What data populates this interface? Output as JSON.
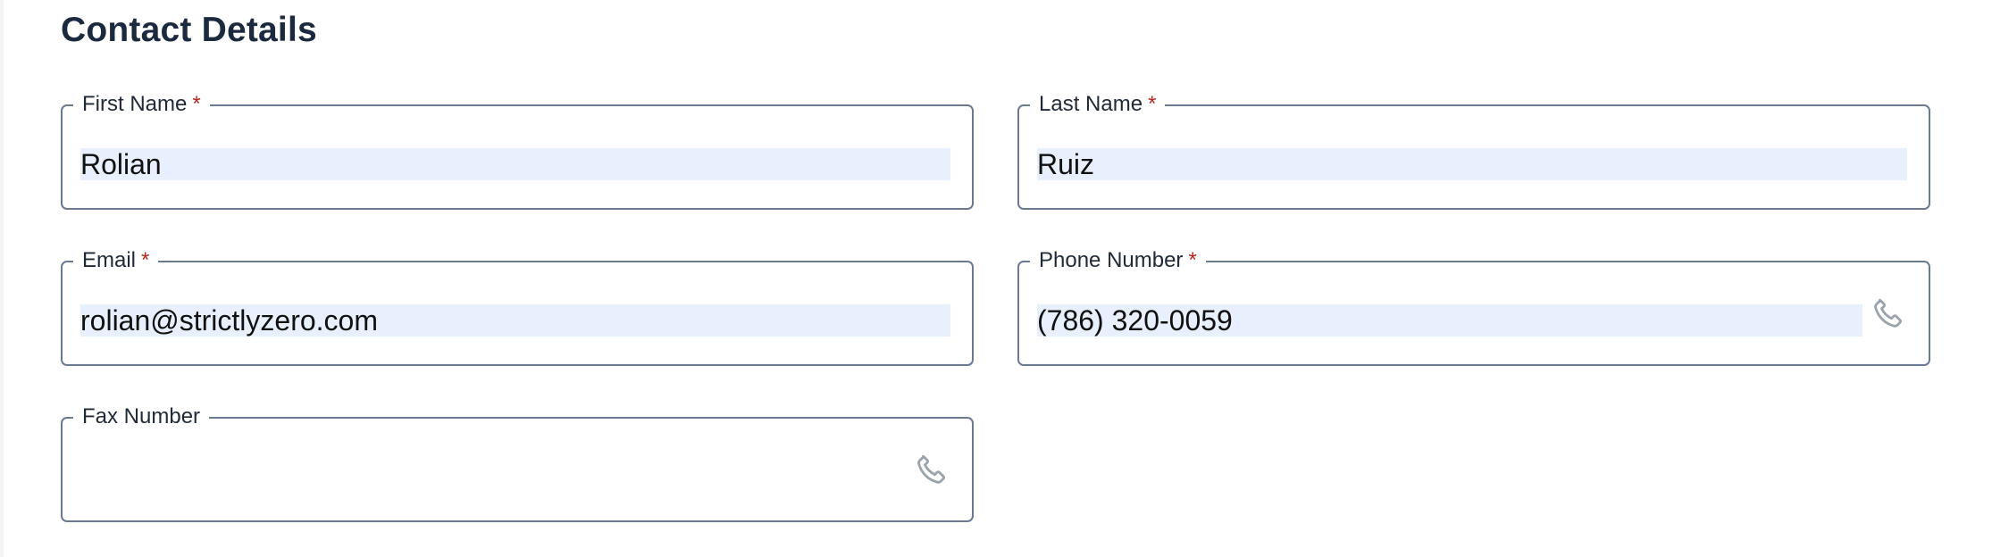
{
  "section": {
    "title": "Contact Details"
  },
  "required_marker": "*",
  "fields": {
    "first_name": {
      "label": "First Name",
      "value": "Rolian",
      "required": true
    },
    "last_name": {
      "label": "Last Name",
      "value": "Ruiz",
      "required": true
    },
    "email": {
      "label": "Email",
      "value": "rolian@strictlyzero.com",
      "required": true
    },
    "phone": {
      "label": "Phone Number",
      "value": "(786) 320-0059",
      "required": true,
      "icon": "phone-icon"
    },
    "fax": {
      "label": "Fax Number",
      "value": "",
      "required": false,
      "icon": "phone-icon"
    }
  },
  "colors": {
    "title": "#1c2a3f",
    "border": "#6b7a93",
    "required": "#b3261e",
    "autofill": "#e8f0fe",
    "icon": "#9aa3ad"
  }
}
